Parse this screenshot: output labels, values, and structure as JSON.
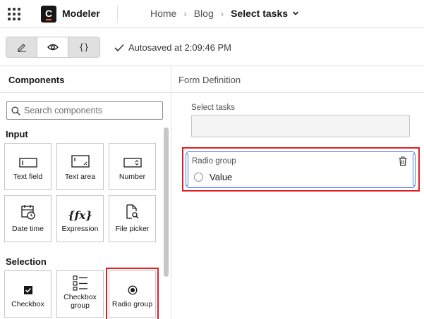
{
  "header": {
    "app_name": "Modeler",
    "logo_letter": "C",
    "breadcrumb": [
      "Home",
      "Blog",
      "Select tasks"
    ]
  },
  "toolbar": {
    "modes": [
      {
        "name": "edit",
        "icon": "pencil-icon"
      },
      {
        "name": "preview",
        "icon": "eye-icon",
        "active": true
      },
      {
        "name": "json",
        "icon": "braces-icon",
        "label": "{}"
      }
    ],
    "autosave": "Autosaved at 2:09:46 PM"
  },
  "components": {
    "title": "Components",
    "search_placeholder": "Search components",
    "sections": [
      {
        "title": "Input",
        "items": [
          {
            "label": "Text field",
            "icon": "text-field-icon"
          },
          {
            "label": "Text area",
            "icon": "text-area-icon"
          },
          {
            "label": "Number",
            "icon": "number-icon"
          },
          {
            "label": "Date time",
            "icon": "calendar-clock-icon"
          },
          {
            "label": "Expression",
            "icon": "function-icon",
            "glyph": "{fx}"
          },
          {
            "label": "File picker",
            "icon": "file-search-icon"
          }
        ]
      },
      {
        "title": "Selection",
        "items": [
          {
            "label": "Checkbox",
            "icon": "checkbox-icon"
          },
          {
            "label": "Checkbox group",
            "icon": "checkbox-group-icon"
          },
          {
            "label": "Radio group",
            "icon": "radio-icon",
            "selected": true
          }
        ]
      }
    ]
  },
  "form": {
    "title": "Form Definition",
    "field_label": "Select tasks",
    "field_value": "",
    "radio_group": {
      "label": "Radio group",
      "option": "Value"
    }
  },
  "colors": {
    "highlight": "#e02020",
    "selection": "#4a7cf0",
    "accent": "#fc5d0d"
  }
}
